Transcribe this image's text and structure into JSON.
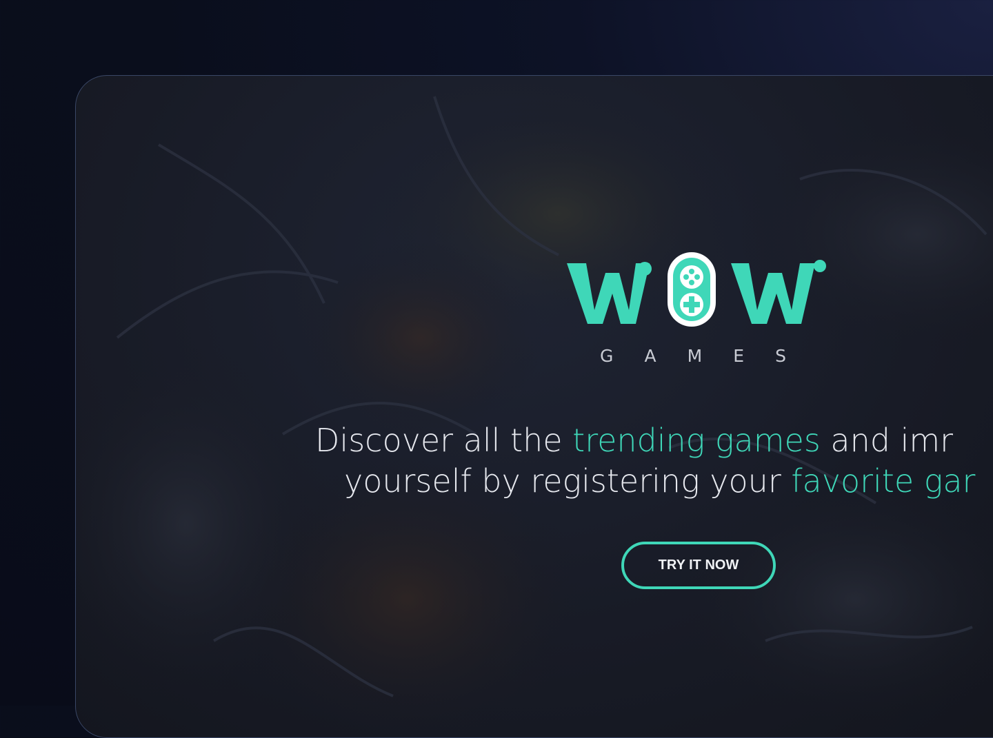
{
  "brand": {
    "logo_word": "WOW",
    "subtitle_letters": [
      "G",
      "A",
      "M",
      "E",
      "S"
    ],
    "accent_color": "#3fd7b8"
  },
  "hero": {
    "line1_a": "Discover all the ",
    "line1_b": "trending games",
    "line1_c": " and imr",
    "line2_a": "yourself by registering your ",
    "line2_b": "favorite gar"
  },
  "cta": {
    "label": "TRY IT NOW"
  },
  "background": {
    "artwork": "dark-fantasy-dragon-illustration"
  }
}
